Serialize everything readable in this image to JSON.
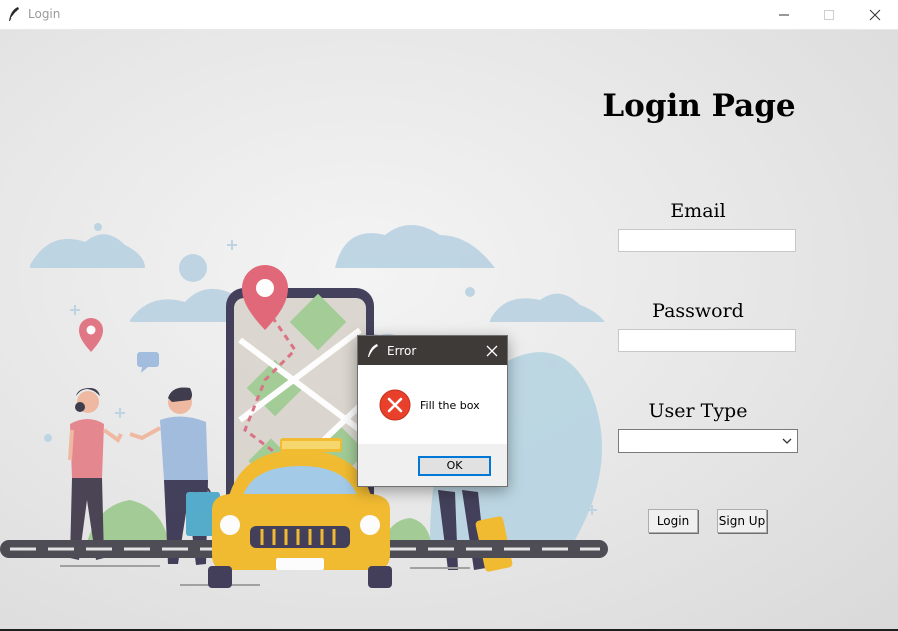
{
  "window": {
    "title": "Login",
    "controls": {
      "minimize_icon": "minimize-icon",
      "maximize_icon": "maximize-icon",
      "close_icon": "close-icon"
    }
  },
  "page": {
    "heading": "Login Page",
    "email": {
      "label": "Email",
      "value": ""
    },
    "password": {
      "label": "Password",
      "value": ""
    },
    "user_type": {
      "label": "User Type",
      "selected": ""
    },
    "buttons": {
      "login": "Login",
      "signup": "Sign Up"
    },
    "illustration": "taxi-booking-illustration"
  },
  "dialog": {
    "title": "Error",
    "message": "Fill the box",
    "ok_label": "OK",
    "icon": "error-icon"
  },
  "colors": {
    "dialog_titlebar": "#3d3a37",
    "error_red": "#e8402a",
    "focus_blue": "#0078d7",
    "taxi_yellow": "#f2b61e"
  }
}
